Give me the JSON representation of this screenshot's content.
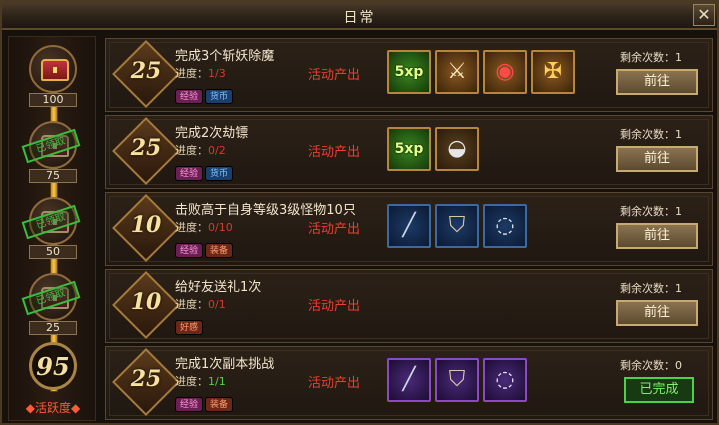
{
  "window": {
    "title": "日常",
    "close_glyph": "✕"
  },
  "sidebar": {
    "milestones": [
      {
        "value": "100",
        "claimed": false,
        "stamp": ""
      },
      {
        "value": "75",
        "claimed": true,
        "stamp": "已领取"
      },
      {
        "value": "50",
        "claimed": true,
        "stamp": "已领取"
      },
      {
        "value": "25",
        "claimed": true,
        "stamp": "已领取"
      }
    ],
    "total": "95",
    "total_label": "◆活跃度◆"
  },
  "tasks": [
    {
      "points": "25",
      "name": "完成3个斩妖除魔",
      "progress_label": "进度：",
      "progress_value": "1/3",
      "completed": false,
      "tags": [
        "经验",
        "货币"
      ],
      "source": "活动产出",
      "rewards": [
        "exp-icon",
        "wings-icon",
        "jewel-icon",
        "crossed-swords-icon"
      ],
      "remain_label": "剩余次数：1",
      "action": "前往"
    },
    {
      "points": "25",
      "name": "完成2次劫镖",
      "progress_label": "进度：",
      "progress_value": "0/2",
      "completed": false,
      "tags": [
        "经验",
        "货币"
      ],
      "source": "活动产出",
      "rewards": [
        "exp-icon",
        "silver-ingot-icon"
      ],
      "remain_label": "剩余次数：1",
      "action": "前往"
    },
    {
      "points": "10",
      "name": "击败高于自身等级3级怪物10只",
      "progress_label": "进度：",
      "progress_value": "0/10",
      "completed": false,
      "tags": [
        "经验",
        "装备"
      ],
      "source": "活动产出",
      "rewards": [
        "sword-icon",
        "armor-icon",
        "necklace-icon"
      ],
      "remain_label": "剩余次数：1",
      "action": "前往"
    },
    {
      "points": "10",
      "name": "给好友送礼1次",
      "progress_label": "进度：",
      "progress_value": "0/1",
      "completed": false,
      "tags": [
        "好感"
      ],
      "source": "活动产出",
      "rewards": [],
      "remain_label": "剩余次数：1",
      "action": "前往"
    },
    {
      "points": "25",
      "name": "完成1次副本挑战",
      "progress_label": "进度：",
      "progress_value": "1/1",
      "completed": true,
      "tags": [
        "经验",
        "装备"
      ],
      "source": "活动产出",
      "rewards": [
        "sword-icon",
        "armor-icon",
        "necklace-icon"
      ],
      "remain_label": "剩余次数：0",
      "action": "已完成"
    }
  ],
  "colors": {
    "progress_incomplete": "#d63a2c",
    "progress_complete": "#4cd24a",
    "source_text": "#e84030",
    "done_accent": "#4cd24a"
  }
}
